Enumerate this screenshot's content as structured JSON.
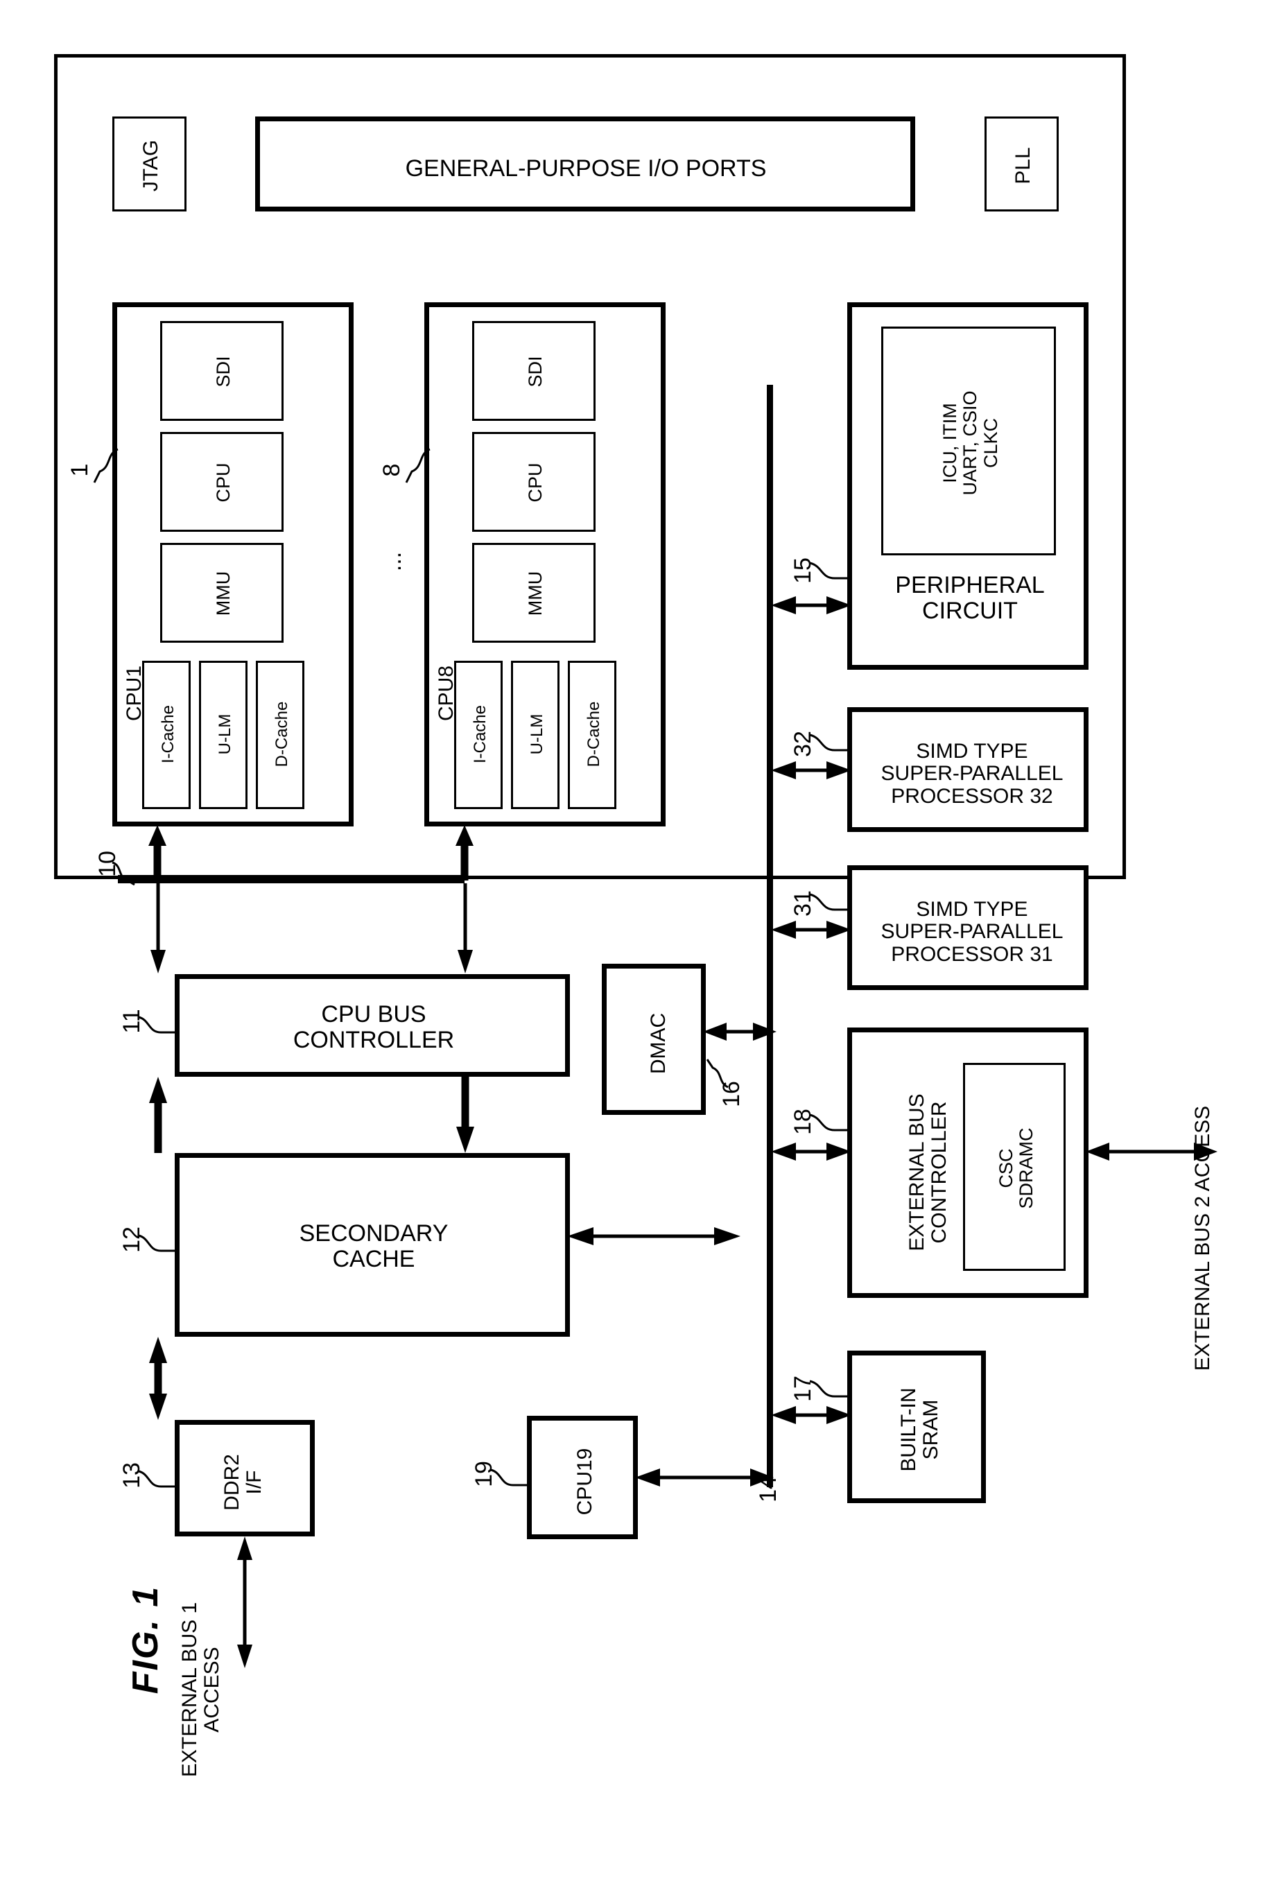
{
  "figure": {
    "label": "FIG. 1",
    "type": "patent-block-diagram",
    "orientation": "rotated-90-ccw"
  },
  "chip": {
    "top_blocks": {
      "jtag": "JTAG",
      "gpio": "GENERAL-PURPOSE I/O PORTS",
      "pll": "PLL"
    },
    "cpu_cores": [
      {
        "ref": "1",
        "name": "CPU1",
        "units": [
          "SDI",
          "CPU",
          "MMU"
        ],
        "memories": [
          "I-Cache",
          "U-LM",
          "D-Cache"
        ]
      },
      {
        "ref": "8",
        "name": "CPU8",
        "units": [
          "SDI",
          "CPU",
          "MMU"
        ],
        "memories": [
          "I-Cache",
          "U-LM",
          "D-Cache"
        ]
      }
    ],
    "ellipsis": "...",
    "bus_ref": "10",
    "left_blocks": [
      {
        "ref": "11",
        "label": "CPU BUS\nCONTROLLER"
      },
      {
        "ref": "12",
        "label": "SECONDARY\nCACHE"
      },
      {
        "ref": "13",
        "label": "DDR2\nI/F"
      }
    ],
    "dmac": {
      "ref": "16",
      "label": "DMAC"
    },
    "cpu19": {
      "ref": "19",
      "label": "CPU19"
    },
    "right_blocks": [
      {
        "ref": "15",
        "label": "PERIPHERAL\nCIRCUIT",
        "inner": "ICU, ITIM\nUART, CSIO\nCLKC"
      },
      {
        "ref": "32",
        "label": "SIMD TYPE\nSUPER-PARALLEL\nPROCESSOR 32"
      },
      {
        "ref": "31",
        "label": "SIMD TYPE\nSUPER-PARALLEL\nPROCESSOR 31"
      },
      {
        "ref": "18",
        "label": "EXTERNAL BUS\nCONTROLLER",
        "inner": "CSC\nSDRAMC"
      },
      {
        "ref": "17",
        "label": "BUILT-IN\nSRAM"
      }
    ],
    "internal_bus_ref": "14"
  },
  "external": {
    "bus1": "EXTERNAL BUS 1\nACCESS",
    "bus2": "EXTERNAL BUS 2 ACCESS"
  }
}
